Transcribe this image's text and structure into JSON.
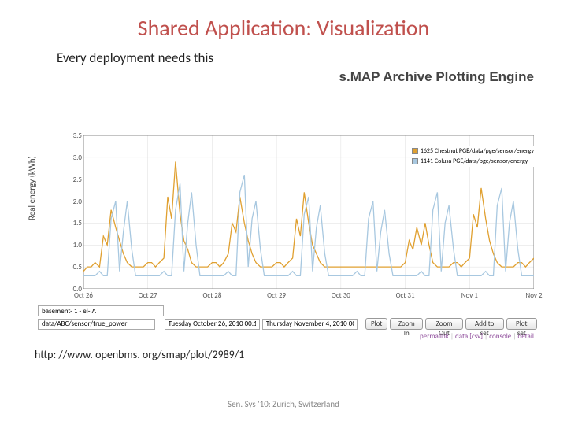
{
  "title": "Shared Application: Visualization",
  "subtitle": "Every deployment needs this",
  "app_title": "s.MAP Archive Plotting Engine",
  "yaxis": "Real energy (kWh)",
  "url": "http: //www. openbms. org/smap/plot/2989/1",
  "footer": "Sen. Sys '10: Zurich, Switzerland",
  "legend": {
    "a": {
      "label": "1625 Chestnut PGE/data/pge/sensor/energy",
      "color": "#e0a030"
    },
    "b": {
      "label": "1141 Colusa PGE/data/pge/sensor/energy",
      "color": "#a8c8e0"
    }
  },
  "yticks": [
    "0.0",
    "0.5",
    "1.0",
    "1.5",
    "2.0",
    "2.5",
    "3.0",
    "3.5"
  ],
  "xticks": [
    "Oct 26",
    "Oct 27",
    "Oct 28",
    "Oct 29",
    "Oct 30",
    "Oct 31",
    "Nov 1",
    "Nov 2"
  ],
  "controls": {
    "streams_input": "basement- 1 - el- A",
    "path_input": "data/ABC/sensor/true_power",
    "date_from": "Tuesday October 26, 2010 00:1",
    "date_to": "Thursday November 4, 2010 00",
    "buttons": {
      "plot": "Plot",
      "zoomin": "Zoom In",
      "zoomout": "Zoom Out",
      "addset": "Add to set",
      "plotset": "Plot set"
    }
  },
  "crumbs": {
    "permalink": "permalink",
    "data": "data [csv]",
    "console": "console",
    "detail": "detail",
    "sep": "  |  "
  },
  "chart_data": {
    "type": "line",
    "xlabel": "",
    "ylabel": "Real energy (kWh)",
    "ylim": [
      0,
      3.5
    ],
    "categories": [
      "Oct 26",
      "Oct 27",
      "Oct 28",
      "Oct 29",
      "Oct 30",
      "Oct 31",
      "Nov 1",
      "Nov 2"
    ],
    "series": [
      {
        "name": "1625 Chestnut PGE/data/pge/sensor/energy",
        "color": "#e0a030",
        "x": [
          0,
          0.06,
          0.12,
          0.18,
          0.25,
          0.31,
          0.37,
          0.43,
          0.5,
          0.56,
          0.62,
          0.68,
          0.75,
          0.81,
          0.87,
          0.93,
          1,
          1.06,
          1.12,
          1.18,
          1.25,
          1.31,
          1.37,
          1.43,
          1.5,
          1.56,
          1.62,
          1.68,
          1.75,
          1.81,
          1.87,
          1.93,
          2,
          2.06,
          2.12,
          2.18,
          2.25,
          2.31,
          2.37,
          2.43,
          2.5,
          2.56,
          2.62,
          2.68,
          2.75,
          2.81,
          2.87,
          2.93,
          3,
          3.06,
          3.12,
          3.18,
          3.25,
          3.31,
          3.37,
          3.43,
          3.5,
          3.56,
          3.62,
          3.68,
          3.75,
          3.81,
          3.87,
          3.93,
          4,
          4.06,
          4.12,
          4.18,
          4.25,
          4.31,
          4.37,
          4.43,
          4.5,
          4.56,
          4.62,
          4.68,
          4.75,
          4.81,
          4.87,
          4.93,
          5,
          5.06,
          5.12,
          5.18,
          5.25,
          5.31,
          5.37,
          5.43,
          5.5,
          5.56,
          5.62,
          5.68,
          5.75,
          5.81,
          5.87,
          5.93,
          6,
          6.06,
          6.12,
          6.18,
          6.25,
          6.31,
          6.37,
          6.43,
          6.5,
          6.56,
          6.62,
          6.68,
          6.75,
          6.81,
          6.87,
          6.93,
          7
        ],
        "values": [
          0.4,
          0.5,
          0.5,
          0.6,
          0.5,
          1.2,
          1.0,
          1.8,
          1.4,
          1.1,
          0.8,
          0.6,
          0.5,
          0.5,
          0.5,
          0.5,
          0.6,
          0.6,
          0.5,
          0.6,
          0.7,
          2.1,
          1.6,
          2.9,
          1.7,
          1.1,
          0.9,
          0.6,
          0.5,
          0.5,
          0.5,
          0.5,
          0.6,
          0.6,
          0.5,
          0.6,
          0.8,
          1.5,
          1.3,
          2.1,
          1.5,
          1.1,
          0.8,
          0.6,
          0.5,
          0.5,
          0.5,
          0.5,
          0.6,
          0.6,
          0.5,
          0.6,
          0.7,
          1.6,
          1.2,
          2.2,
          1.5,
          1.0,
          0.8,
          0.6,
          0.5,
          0.5,
          0.5,
          0.5,
          0.5,
          0.5,
          0.5,
          0.5,
          0.5,
          0.5,
          0.5,
          0.5,
          0.5,
          0.5,
          0.5,
          0.5,
          0.5,
          0.5,
          0.5,
          0.5,
          0.6,
          1.1,
          0.9,
          1.4,
          1.0,
          1.5,
          1.0,
          0.6,
          0.5,
          0.5,
          0.5,
          0.5,
          0.6,
          0.6,
          0.5,
          0.6,
          0.7,
          1.7,
          1.4,
          2.3,
          1.6,
          1.1,
          0.8,
          0.6,
          0.5,
          0.5,
          0.5,
          0.5,
          0.6,
          0.6,
          0.5,
          0.6,
          0.7
        ]
      },
      {
        "name": "1141 Colusa PGE/data/pge/sensor/energy",
        "color": "#a8c8e0",
        "x": [
          0,
          0.06,
          0.12,
          0.18,
          0.25,
          0.31,
          0.37,
          0.43,
          0.5,
          0.56,
          0.62,
          0.68,
          0.75,
          0.81,
          0.87,
          0.93,
          1,
          1.06,
          1.12,
          1.18,
          1.25,
          1.31,
          1.37,
          1.43,
          1.5,
          1.56,
          1.62,
          1.68,
          1.75,
          1.81,
          1.87,
          1.93,
          2,
          2.06,
          2.12,
          2.18,
          2.25,
          2.31,
          2.37,
          2.43,
          2.5,
          2.56,
          2.62,
          2.68,
          2.75,
          2.81,
          2.87,
          2.93,
          3,
          3.06,
          3.12,
          3.18,
          3.25,
          3.31,
          3.37,
          3.43,
          3.5,
          3.56,
          3.62,
          3.68,
          3.75,
          3.81,
          3.87,
          3.93,
          4,
          4.06,
          4.12,
          4.18,
          4.25,
          4.31,
          4.37,
          4.43,
          4.5,
          4.56,
          4.62,
          4.68,
          4.75,
          4.81,
          4.87,
          4.93,
          5,
          5.06,
          5.12,
          5.18,
          5.25,
          5.31,
          5.37,
          5.43,
          5.5,
          5.56,
          5.62,
          5.68,
          5.75,
          5.81,
          5.87,
          5.93,
          6,
          6.06,
          6.12,
          6.18,
          6.25,
          6.31,
          6.37,
          6.43,
          6.5,
          6.56,
          6.62,
          6.68,
          6.75,
          6.81,
          6.87,
          6.93,
          7
        ],
        "values": [
          0.3,
          0.3,
          0.3,
          0.3,
          0.4,
          0.3,
          0.3,
          1.6,
          2.0,
          0.4,
          1.3,
          2.0,
          0.9,
          0.3,
          0.3,
          0.3,
          0.3,
          0.3,
          0.3,
          0.3,
          0.4,
          0.3,
          0.3,
          1.8,
          2.4,
          0.4,
          1.5,
          2.2,
          1.0,
          0.3,
          0.3,
          0.3,
          0.3,
          0.3,
          0.3,
          0.3,
          0.4,
          0.3,
          0.3,
          2.2,
          2.6,
          0.5,
          1.6,
          2.0,
          0.9,
          0.3,
          0.3,
          0.3,
          0.3,
          0.3,
          0.3,
          0.3,
          0.4,
          0.3,
          0.3,
          1.7,
          2.1,
          0.4,
          1.4,
          1.9,
          0.8,
          0.3,
          0.3,
          0.3,
          0.3,
          0.3,
          0.3,
          0.3,
          0.4,
          0.3,
          0.3,
          1.6,
          2.0,
          0.4,
          1.3,
          1.8,
          0.8,
          0.3,
          0.3,
          0.3,
          0.3,
          0.3,
          0.3,
          0.3,
          0.4,
          0.3,
          0.3,
          1.8,
          2.2,
          0.4,
          1.5,
          1.9,
          0.9,
          0.3,
          0.3,
          0.3,
          0.3,
          0.3,
          0.3,
          0.3,
          0.4,
          0.3,
          0.3,
          1.9,
          2.3,
          0.4,
          1.5,
          2.0,
          0.9,
          0.3,
          0.3,
          0.3,
          0.3
        ]
      }
    ]
  }
}
